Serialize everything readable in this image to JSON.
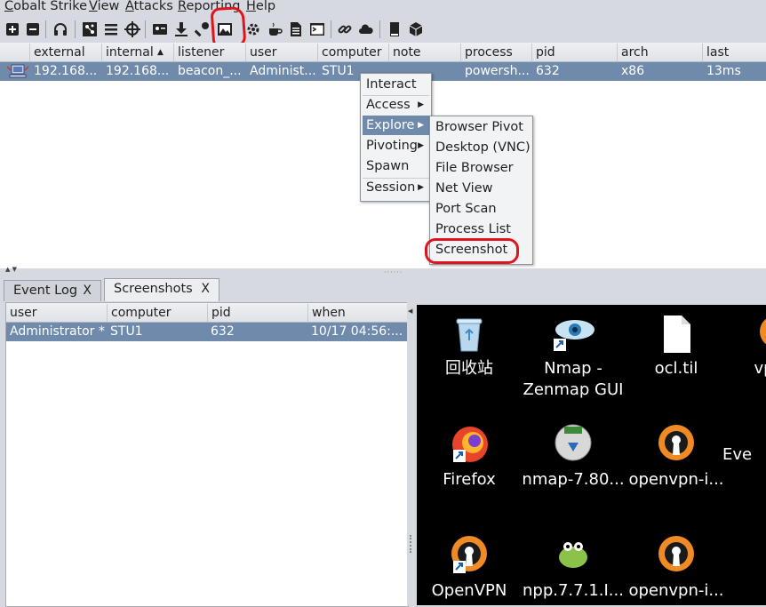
{
  "menubar": {
    "items": [
      {
        "label": "Cobalt Strike",
        "underline": "C"
      },
      {
        "label": "View",
        "underline": "V"
      },
      {
        "label": "Attacks",
        "underline": "A"
      },
      {
        "label": "Reporting",
        "underline": "R"
      },
      {
        "label": "Help",
        "underline": "H"
      }
    ]
  },
  "toolbar": {
    "icons": [
      "connect-icon",
      "disconnect-icon",
      "headphones-icon",
      "pivot-graph-icon",
      "session-table-icon",
      "targets-icon",
      "credentials-icon",
      "downloads-icon",
      "keystrokes-icon",
      "screenshots-icon",
      "payload-generator-icon",
      "java-applet-icon",
      "office-macro-icon",
      "powershell-icon",
      "web-drive-by-icon",
      "cloud-icon",
      "log-icon",
      "box-icon"
    ]
  },
  "beacons": {
    "columns": [
      "",
      "external",
      "internal",
      "listener",
      "user",
      "computer",
      "note",
      "process",
      "pid",
      "arch",
      "last"
    ],
    "sorted_column": "internal",
    "rows": [
      {
        "external": "192.168...",
        "internal": "192.168...",
        "listener": "beacon_...",
        "user": "Administ...",
        "computer": "STU1",
        "note": "",
        "process": "powersh...",
        "pid": "632",
        "arch": "x86",
        "last": "13ms"
      }
    ]
  },
  "context_menu": {
    "items": [
      {
        "label": "Interact",
        "submenu": false
      },
      {
        "label": "Access",
        "submenu": true
      },
      {
        "label": "Explore",
        "submenu": true,
        "active": true
      },
      {
        "label": "Pivoting",
        "submenu": true
      },
      {
        "label": "Spawn",
        "submenu": false
      },
      {
        "label": "Session",
        "submenu": true
      }
    ]
  },
  "explore_submenu": {
    "items": [
      "Browser Pivot",
      "Desktop (VNC)",
      "File Browser",
      "Net View",
      "Port Scan",
      "Process List",
      "Screenshot"
    ],
    "highlighted": "Screenshot"
  },
  "tabs": [
    {
      "label": "Event Log",
      "close": "X"
    },
    {
      "label": "Screenshots",
      "close": "X",
      "selected": true
    }
  ],
  "screenshots": {
    "columns": [
      "user",
      "computer",
      "pid",
      "when"
    ],
    "rows": [
      {
        "user": "Administrator *",
        "computer": "STU1",
        "pid": "632",
        "when": "10/17 04:56:..."
      }
    ]
  },
  "desktop": {
    "icons": [
      {
        "label": "回收站",
        "icon": "recycle-bin-icon"
      },
      {
        "label": "Nmap - Zenmap GUI",
        "icon": "nmap-eye-icon"
      },
      {
        "label": "ocl.til",
        "icon": "file-icon"
      },
      {
        "label": "vpn.c",
        "icon": "openvpn-icon"
      },
      {
        "label": "Firefox",
        "icon": "firefox-icon"
      },
      {
        "label": "nmap-7.80...",
        "icon": "nmap-installer-icon"
      },
      {
        "label": "openvpn-i...",
        "icon": "openvpn-icon"
      },
      {
        "label": "Eve",
        "icon": "app-icon"
      },
      {
        "label": "OpenVPN",
        "icon": "openvpn-icon"
      },
      {
        "label": "npp.7.7.1.I...",
        "icon": "notepadpp-icon"
      },
      {
        "label": "openvpn-i...",
        "icon": "openvpn-icon"
      }
    ]
  },
  "colors": {
    "selection": "#6f8aab",
    "annotation": "#e0141f",
    "window_bg": "#d6d9df"
  }
}
